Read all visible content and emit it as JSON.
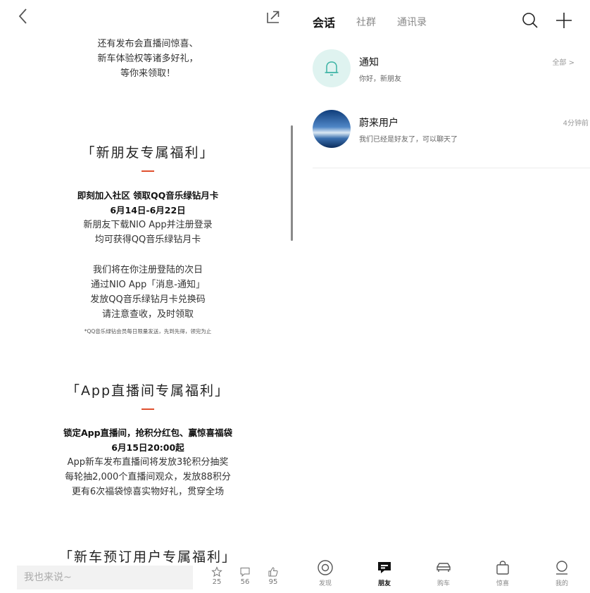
{
  "article": {
    "intro": [
      "还有发布会直播间惊喜、",
      "新车体验权等诸多好礼，",
      "等你来领取！"
    ],
    "section1": {
      "title": "「新朋友专属福利」",
      "bold": [
        "即刻加入社区 领取QQ音乐绿钻月卡",
        "6月14日-6月22日"
      ],
      "para1": [
        "新朋友下载NIO App并注册登录",
        "均可获得QQ音乐绿钻月卡"
      ],
      "para2": [
        "我们将在你注册登陆的次日",
        "通过NIO App「消息-通知」",
        "发放QQ音乐绿钻月卡兑换码",
        "请注意查收，及时领取"
      ],
      "note": "*QQ音乐绿钻会员每日限量发送，先到先得，领完为止"
    },
    "section2": {
      "title": "「App直播间专属福利」",
      "bold": [
        "锁定App直播间，抢积分红包、赢惊喜福袋",
        "6月15日20:00起"
      ],
      "para": [
        "App新车发布直播间将发放3轮积分抽奖",
        "每轮抽2,000个直播间观众，发放88积分",
        "更有6次福袋惊喜实物好礼，贯穿全场"
      ]
    },
    "section3": {
      "title": "「新车预订用户专属福利」"
    }
  },
  "comment_bar": {
    "placeholder": "我也来说~",
    "favorites": "25",
    "comments": "56",
    "likes": "95"
  },
  "messages": {
    "tabs": [
      {
        "label": "会话",
        "active": true
      },
      {
        "label": "社群",
        "active": false
      },
      {
        "label": "通讯录",
        "active": false
      }
    ],
    "conversations": [
      {
        "title": "通知",
        "subtitle": "你好，新朋友",
        "meta": "全部 >"
      },
      {
        "title": "蔚来用户",
        "subtitle": "我们已经是好友了，可以聊天了",
        "meta": "4分钟前"
      }
    ]
  },
  "bottom_nav": [
    {
      "label": "发现",
      "icon": "compass-icon",
      "active": false
    },
    {
      "label": "朋友",
      "icon": "chat-icon",
      "active": true
    },
    {
      "label": "购车",
      "icon": "car-icon",
      "active": false
    },
    {
      "label": "惊喜",
      "icon": "gift-bag-icon",
      "active": false
    },
    {
      "label": "我的",
      "icon": "user-icon",
      "active": false
    }
  ],
  "colors": {
    "accent": "#e0502f",
    "notify_bg": "#dff3f0",
    "notify_icon": "#3bb3a4"
  }
}
